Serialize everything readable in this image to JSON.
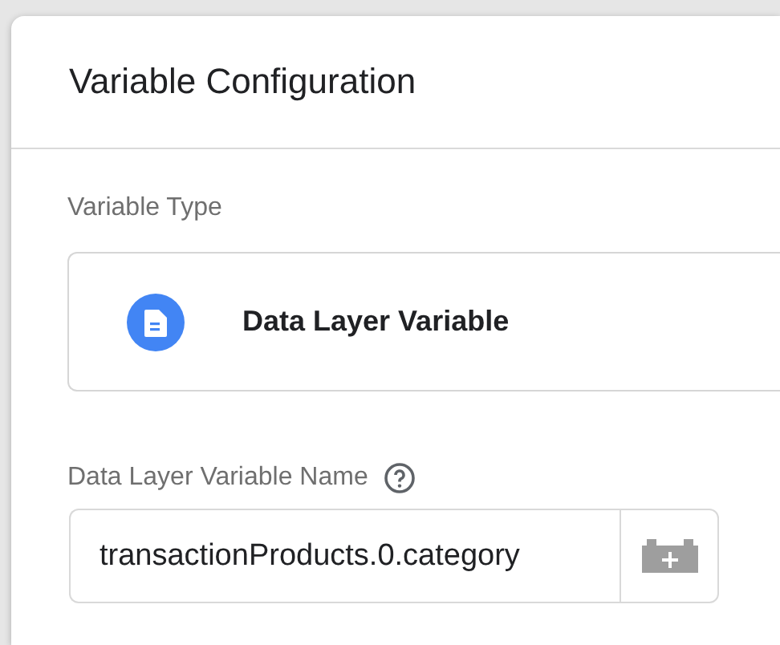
{
  "panel": {
    "title": "Variable Configuration"
  },
  "variable_type": {
    "label": "Variable Type",
    "value": "Data Layer Variable"
  },
  "name_field": {
    "label": "Data Layer Variable Name",
    "value": "transactionProducts.0.category"
  }
}
